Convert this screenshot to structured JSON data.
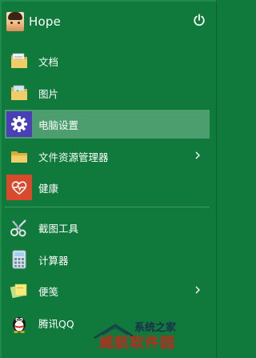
{
  "user": {
    "name": "Hope"
  },
  "menu_items": [
    {
      "label": "文档",
      "icon": "documents-folder-icon"
    },
    {
      "label": "图片",
      "icon": "pictures-folder-icon"
    },
    {
      "label": "电脑设置",
      "icon": "pc-settings-gear-icon",
      "active": true
    },
    {
      "label": "文件资源管理器",
      "icon": "file-explorer-icon",
      "has_submenu": true
    },
    {
      "label": "健康",
      "icon": "health-heart-icon"
    }
  ],
  "app_items": [
    {
      "label": "截图工具",
      "icon": "snipping-tool-icon"
    },
    {
      "label": "计算器",
      "icon": "calculator-icon"
    },
    {
      "label": "便笺",
      "icon": "sticky-notes-icon",
      "has_submenu": true
    },
    {
      "label": "腾讯QQ",
      "icon": "qq-penguin-icon"
    }
  ],
  "watermark": {
    "top": "系统之家",
    "bottom": "威航软件园"
  },
  "colors": {
    "background": "#0f7a3b",
    "active_item": "#4c9e6e",
    "text": "#ffffff",
    "settings_tile": "#4b3fb8",
    "health_tile": "#d9492c"
  }
}
